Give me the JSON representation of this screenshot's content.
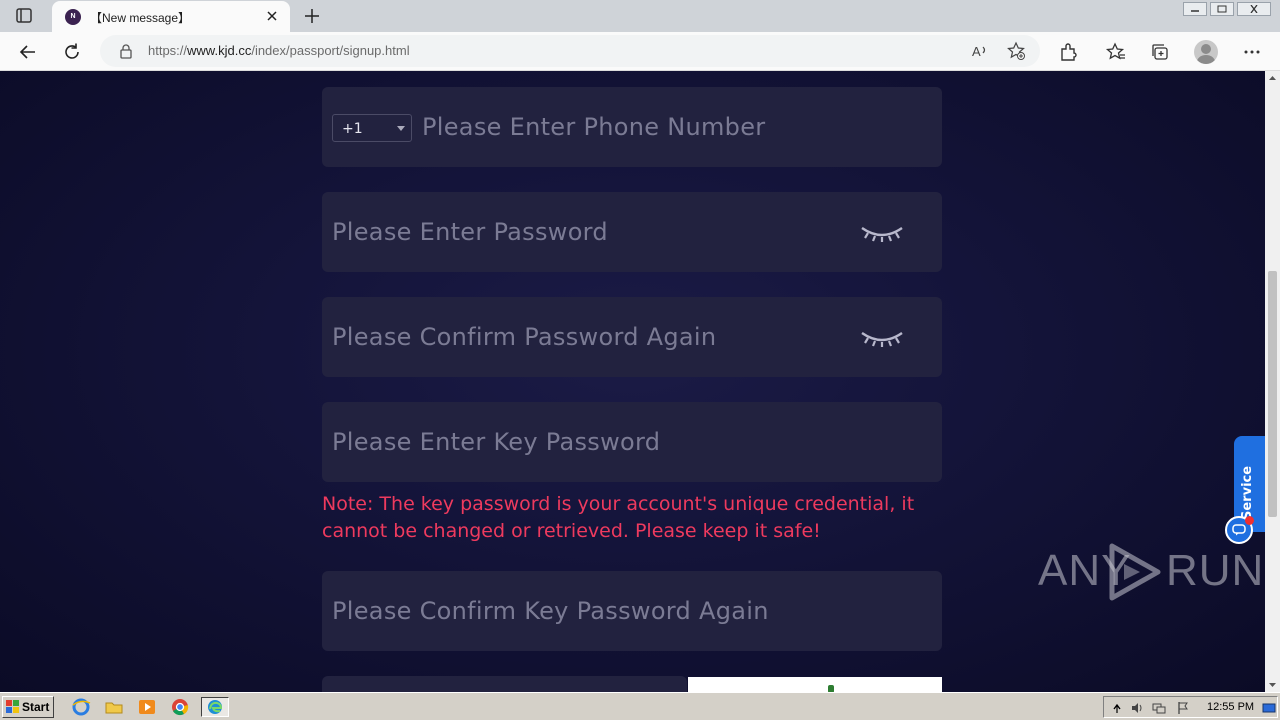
{
  "browser": {
    "tab": {
      "favicon_letter": "N",
      "title": "【New message】"
    },
    "url": {
      "prefix": "https://",
      "host": "www.kjd.cc",
      "path": "/index/passport/signup.html"
    }
  },
  "form": {
    "phone": {
      "country_code": "+1",
      "placeholder": "Please Enter Phone Number"
    },
    "password": {
      "placeholder": "Please Enter Password"
    },
    "confirm_password": {
      "placeholder": "Please Confirm Password Again"
    },
    "key_password": {
      "placeholder": "Please Enter Key Password"
    },
    "note": "Note: The key password is your account's unique credential, it cannot be changed or retrieved. Please keep it safe!",
    "confirm_key_password": {
      "placeholder": "Please Confirm Key Password Again"
    }
  },
  "service": {
    "label": "Service"
  },
  "watermark": {
    "left": "ANY",
    "right": "RUN"
  },
  "taskbar": {
    "start_label": "Start",
    "clock": "12:55 PM"
  },
  "colors": {
    "page_bg": "#14143a",
    "field_bg": "#22223f",
    "placeholder": "#7b7b94",
    "note": "#ee3a5e",
    "service": "#1f6fe0"
  }
}
